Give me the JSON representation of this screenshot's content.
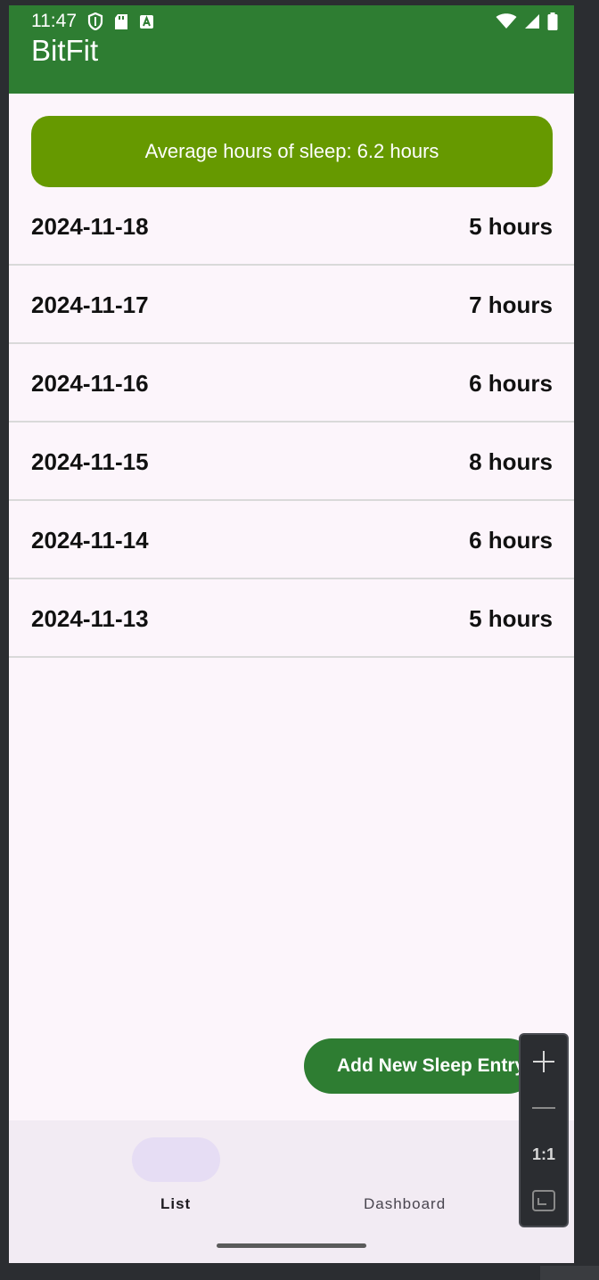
{
  "status_bar": {
    "time": "11:47",
    "left_icons": [
      "shield-icon",
      "sd-card-icon",
      "a-box-icon"
    ],
    "right_icons": [
      "wifi-icon",
      "signal-icon",
      "battery-icon"
    ]
  },
  "app_bar": {
    "title": "BitFit"
  },
  "summary": {
    "text": "Average hours of sleep: 6.2 hours"
  },
  "entries": [
    {
      "date": "2024-11-18",
      "hours": "5 hours"
    },
    {
      "date": "2024-11-17",
      "hours": "7 hours"
    },
    {
      "date": "2024-11-16",
      "hours": "6 hours"
    },
    {
      "date": "2024-11-15",
      "hours": "8 hours"
    },
    {
      "date": "2024-11-14",
      "hours": "6 hours"
    },
    {
      "date": "2024-11-13",
      "hours": "5 hours"
    }
  ],
  "fab": {
    "label": "Add New Sleep Entry"
  },
  "bottom_nav": {
    "items": [
      {
        "label": "List",
        "selected": true
      },
      {
        "label": "Dashboard",
        "selected": false
      }
    ]
  },
  "emulator_zoom": {
    "reset_label": "1:1"
  },
  "colors": {
    "app_bar": "#2e7d32",
    "summary_banner": "#669900",
    "fab": "#2e7d32",
    "background": "#fcf5fb",
    "nav_background": "#f2ebf3",
    "nav_indicator": "#e6ddf4"
  }
}
